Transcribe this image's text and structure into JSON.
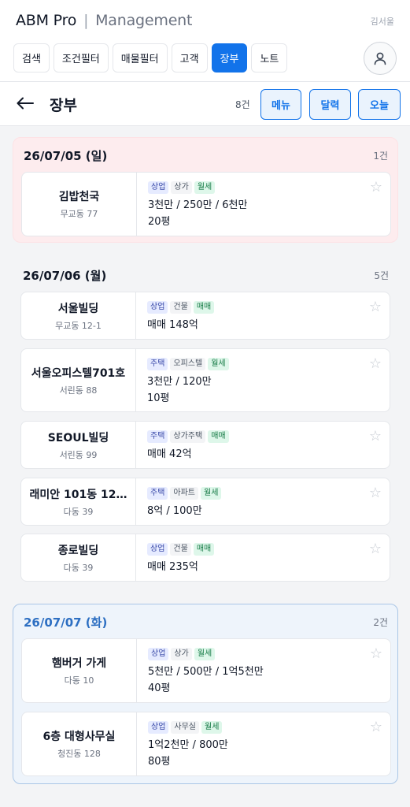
{
  "header": {
    "brand": "ABM Pro",
    "separator": "|",
    "brand_sub": "Management",
    "user_name": "김서울",
    "tabs": [
      {
        "label": "검색",
        "active": false
      },
      {
        "label": "조건필터",
        "active": false
      },
      {
        "label": "매물필터",
        "active": false
      },
      {
        "label": "고객",
        "active": false
      },
      {
        "label": "장부",
        "active": true
      },
      {
        "label": "노트",
        "active": false
      }
    ]
  },
  "subbar": {
    "back_icon": "←",
    "title": "장부",
    "total_count": "8건",
    "menu_label": "메뉴",
    "calendar_label": "달력",
    "today_label": "오늘"
  },
  "groups": [
    {
      "date": "26/07/05 (일)",
      "count": "1건",
      "style": "red",
      "items": [
        {
          "name": "김밥천국",
          "address": "무교동 77",
          "category": "상업",
          "type": "상가",
          "deal": "월세",
          "price": "3천만 / 250만 / 6천만",
          "area": "20평"
        }
      ]
    },
    {
      "date": "26/07/06 (월)",
      "count": "5건",
      "style": "plain",
      "items": [
        {
          "name": "서울빌딩",
          "address": "무교동 12-1",
          "category": "상업",
          "type": "건물",
          "deal": "매매",
          "price": "매매 148억",
          "area": ""
        },
        {
          "name": "서울오피스텔701호",
          "address": "서린동 88",
          "category": "주택",
          "type": "오피스텔",
          "deal": "월세",
          "price": "3천만 / 120만",
          "area": "10평"
        },
        {
          "name": "SEOUL빌딩",
          "address": "서린동 99",
          "category": "주택",
          "type": "상가주택",
          "deal": "매매",
          "price": "매매 42억",
          "area": ""
        },
        {
          "name": "래미안 101동 12…",
          "address": "다동 39",
          "category": "주택",
          "type": "아파트",
          "deal": "월세",
          "price": "8억 / 100만",
          "area": ""
        },
        {
          "name": "종로빌딩",
          "address": "다동 39",
          "category": "상업",
          "type": "건물",
          "deal": "매매",
          "price": "매매 235억",
          "area": ""
        }
      ]
    },
    {
      "date": "26/07/07 (화)",
      "count": "2건",
      "style": "blue",
      "items": [
        {
          "name": "햄버거 가게",
          "address": "다동 10",
          "category": "상업",
          "type": "상가",
          "deal": "월세",
          "price": "5천만 / 500만 / 1억5천만",
          "area": "40평"
        },
        {
          "name": "6층 대형사무실",
          "address": "청진동 128",
          "category": "상업",
          "type": "사무실",
          "deal": "월세",
          "price": "1억2천만 / 800만",
          "area": "80평"
        }
      ]
    }
  ],
  "icons": {
    "star": "☆",
    "user": "user-icon"
  },
  "colors": {
    "primary": "#1273ea",
    "today_group": "#2d6fc2",
    "weekend_group": "#fdecee"
  }
}
